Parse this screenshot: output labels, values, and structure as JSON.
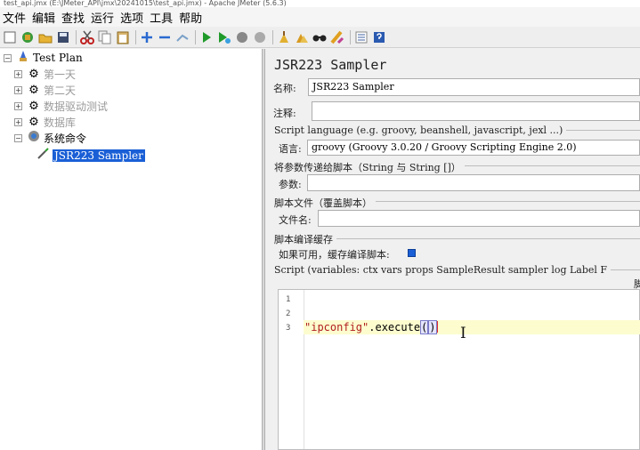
{
  "window": {
    "title": "test_api.jmx (E:\\JMeter_API\\jmx\\20241015\\test_api.jmx) - Apache JMeter (5.6.3)"
  },
  "menu": [
    "文件",
    "编辑",
    "查找",
    "运行",
    "选项",
    "工具",
    "帮助"
  ],
  "toolbar": {
    "icons": [
      "new-icon",
      "templates-icon",
      "open-icon",
      "save-icon",
      "cut-icon",
      "copy-icon",
      "paste-icon",
      "expand-icon",
      "collapse-icon",
      "toggle-icon",
      "start-icon",
      "start-no-pause-icon",
      "stop-icon",
      "shutdown-icon",
      "clear-icon",
      "clear-all-icon",
      "search-icon",
      "reset-search-icon",
      "function-helper-icon",
      "help-icon"
    ]
  },
  "tree": {
    "root": "Test Plan",
    "children": [
      "第一天",
      "第二天",
      "数据驱动测试",
      "数据库",
      "系统命令"
    ],
    "selected": "JSR223 Sampler"
  },
  "panel": {
    "title": "JSR223 Sampler",
    "name_label": "名称:",
    "name_value": "JSR223 Sampler",
    "comment_label": "注释:",
    "comment_value": "",
    "lang_group": "Script language (e.g. groovy, beanshell, javascript, jexl ...)",
    "lang_label": "语言:",
    "lang_value": "groovy     (Groovy 3.0.20 / Groovy Scripting Engine 2.0)",
    "params_group": "将参数传递给脚本（String 与 String []）",
    "params_label": "参数:",
    "params_value": "",
    "file_group": "脚本文件（覆盖脚本）",
    "file_label": "文件名:",
    "file_value": "",
    "cache_group": "脚本编译缓存",
    "cache_label": "如果可用，缓存编译脚本:",
    "cache_checked": true,
    "script_group": "Script (variables: ctx vars props SampleResult sampler log Label F",
    "script_group_tail": "脚",
    "line_numbers": [
      "1",
      "2",
      "3"
    ],
    "code_string": "\"ipconfig\"",
    "code_rest": ".execute",
    "code_open": "(",
    "code_close": ")"
  }
}
